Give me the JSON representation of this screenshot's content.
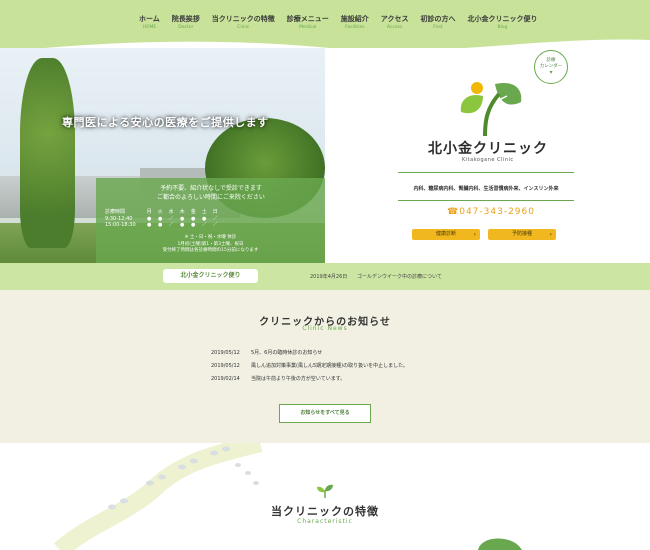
{
  "nav": {
    "items": [
      {
        "jp": "ホーム",
        "en": "HOME"
      },
      {
        "jp": "院長挨拶",
        "en": "Doctor"
      },
      {
        "jp": "当クリニックの特徴",
        "en": "Clinic"
      },
      {
        "jp": "診療メニュー",
        "en": "Medical"
      },
      {
        "jp": "施設紹介",
        "en": "Facilities"
      },
      {
        "jp": "アクセス",
        "en": "Access"
      },
      {
        "jp": "初診の方へ",
        "en": "First"
      },
      {
        "jp": "北小金クリニック便り",
        "en": "Blog"
      }
    ]
  },
  "hero": {
    "tagline": "専門医による安心の医療をご提供します",
    "intro_line1": "予約不要、紹介状なしで受診できます",
    "intro_line2": "ご都合のよろしい時間にご来院ください",
    "hours_header": [
      "診療時間",
      "月",
      "火",
      "水",
      "木",
      "金",
      "土",
      "日"
    ],
    "hours_rows": [
      [
        "9:30-12:40",
        "●",
        "●",
        "／",
        "●",
        "●",
        "●",
        "／"
      ],
      [
        "15:00-18:30",
        "●",
        "●",
        "／",
        "●",
        "●",
        "／",
        "／"
      ]
    ],
    "note1": "※ 土・日・祝・水曜 休診",
    "note2": "1月初(土曜)第1・第3土曜、祝日",
    "note3": "受付終了時間は各診療時間の15分前になります"
  },
  "brand": {
    "calendar_badge": [
      "診療",
      "カレンダー"
    ],
    "name": "北小金クリニック",
    "name_en": "Kitakogane Clinic",
    "departments": "内科、糖尿病内科、腎臓内科、生活習慣病外来、インスリン外来",
    "phone": "047-343-2960",
    "btn_schedule": "健康診断",
    "btn_reserve": "予防接種"
  },
  "strip": {
    "label": "北小金クリニック便り",
    "date": "2019年4月26日",
    "text": "ゴールデンウイーク中の診療について"
  },
  "notices": {
    "title": "クリニックからのお知らせ",
    "subtitle": "Clinic News",
    "items": [
      {
        "date": "2019/05/12",
        "text": "5月、6月の臨時休診のお知らせ"
      },
      {
        "date": "2019/05/12",
        "text": "風しん追加対策事業(風しん5期定期接種)の取り扱いを中止しました。"
      },
      {
        "date": "2019/02/14",
        "text": "当院は午前より午後の方が空いています。"
      }
    ],
    "all_button": "お知らせをすべて見る"
  },
  "features": {
    "title": "当クリニックの特徴",
    "subtitle": "Characteristic"
  },
  "colors": {
    "accent_green": "#6aa84f",
    "nav_bg": "#c8e29a",
    "strip_bg": "#cde5a3",
    "notice_bg": "#f2f0e3",
    "button_yellow": "#f0b81e",
    "phone_orange": "#e7a21c"
  }
}
